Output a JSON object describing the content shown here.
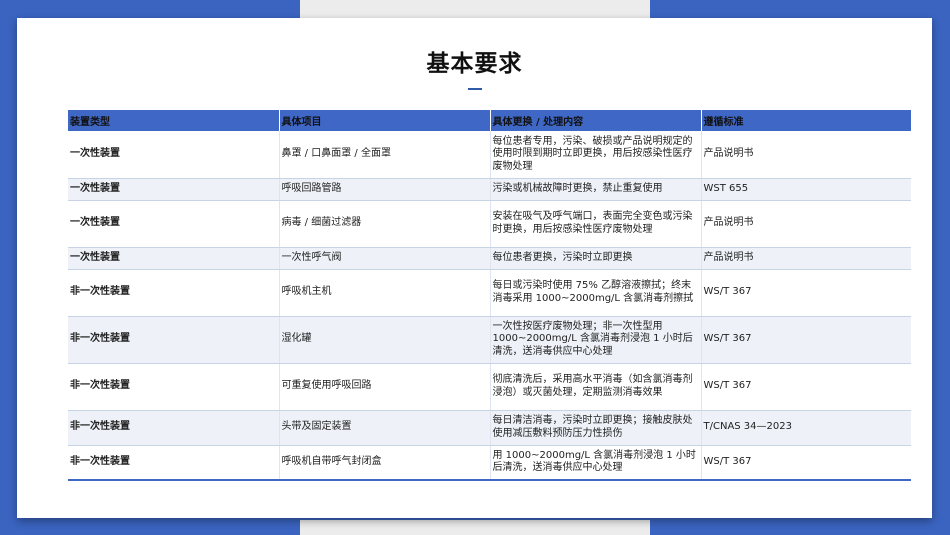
{
  "slide": {
    "title": "基本要求"
  },
  "table": {
    "headers": [
      "装置类型",
      "具体项目",
      "具体更换 / 处理内容",
      "遵循标准"
    ],
    "rows": [
      {
        "type": "一次性装置",
        "item": "鼻罩 / 口鼻面罩 / 全面罩",
        "content": "每位患者专用，污染、破损或产品说明规定的使用时限到期时立即更换，用后按感染性医疗废物处理",
        "standard": "产品说明书"
      },
      {
        "type": "一次性装置",
        "item": "呼吸回路管路",
        "content": "污染或机械故障时更换，禁止重复使用",
        "standard": "WST 655"
      },
      {
        "type": "一次性装置",
        "item": "病毒 / 细菌过滤器",
        "content": "安装在吸气及呼气端口，表面完全变色或污染时更换，用后按感染性医疗废物处理",
        "standard": "产品说明书"
      },
      {
        "type": "一次性装置",
        "item": "一次性呼气阀",
        "content": "每位患者更换，污染时立即更换",
        "standard": "产品说明书"
      },
      {
        "type": "非一次性装置",
        "item": "呼吸机主机",
        "content": "每日或污染时使用 75% 乙醇溶液擦拭；终末消毒采用 1000~2000mg/L 含氯消毒剂擦拭",
        "standard": "WS/T 367"
      },
      {
        "type": "非一次性装置",
        "item": "湿化罐",
        "content": "一次性按医疗废物处理；非一次性型用 1000~2000mg/L 含氯消毒剂浸泡 1 小时后清洗，送消毒供应中心处理",
        "standard": "WS/T 367"
      },
      {
        "type": "非一次性装置",
        "item": "可重复使用呼吸回路",
        "content": "彻底清洗后，采用高水平消毒（如含氯消毒剂浸泡）或灭菌处理，定期监测消毒效果",
        "standard": "WS/T 367"
      },
      {
        "type": "非一次性装置",
        "item": "头带及固定装置",
        "content": "每日清洁消毒，污染时立即更换；接触皮肤处使用减压敷料预防压力性损伤",
        "standard": "T/CNAS 34—2023"
      },
      {
        "type": "非一次性装置",
        "item": "呼吸机自带呼气封闭盒",
        "content": "用 1000~2000mg/L 含氯消毒剂浸泡 1 小时后清洗，送消毒供应中心处理",
        "standard": "WS/T 367"
      }
    ]
  },
  "colors": {
    "accent": "#3a64c0",
    "header_bg": "#3f67c6",
    "alt_row": "#eef2f8"
  }
}
